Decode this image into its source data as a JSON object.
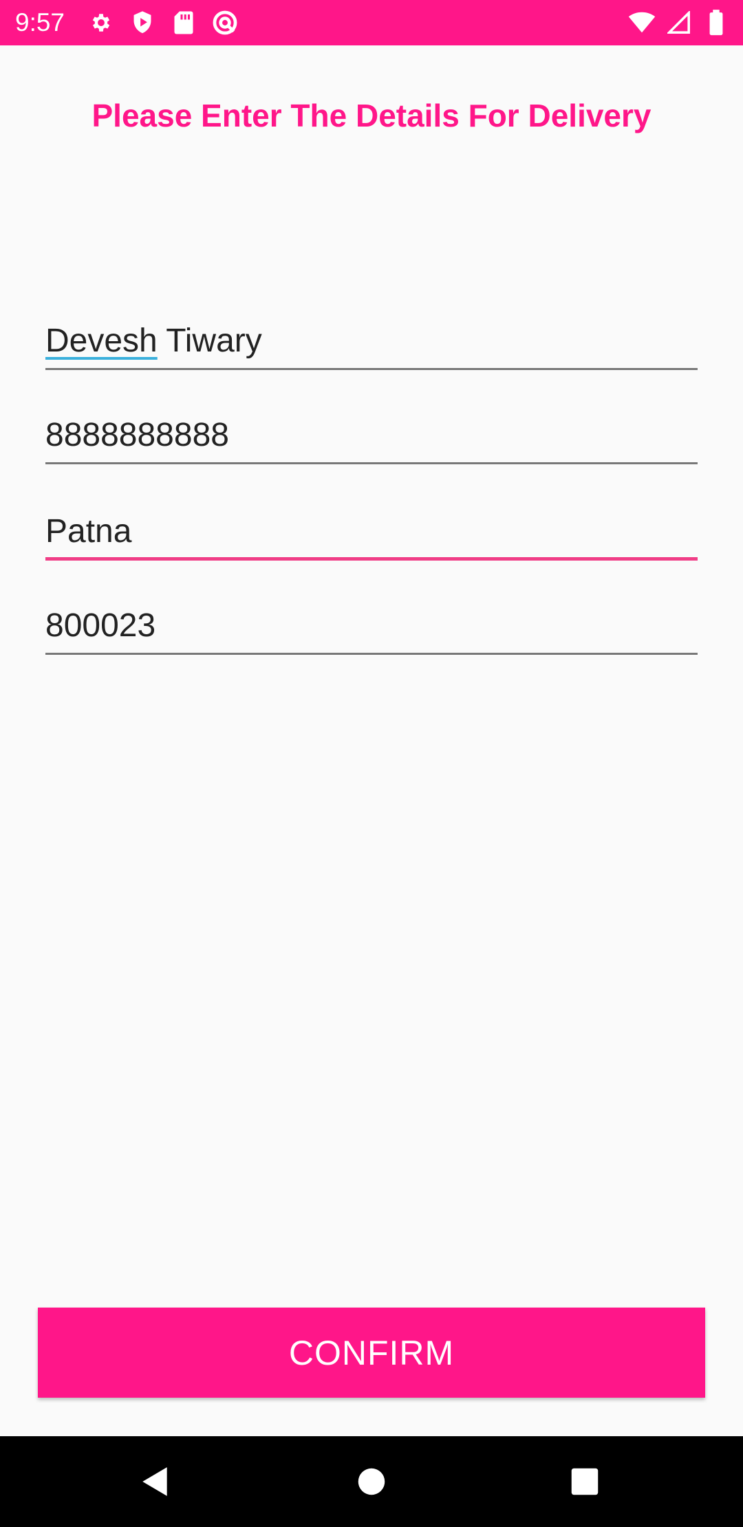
{
  "status_bar": {
    "time": "9:57",
    "left_icons": [
      "gear-icon",
      "shield-play-icon",
      "sd-card-icon",
      "at-sign-icon"
    ],
    "right_icons": [
      "wifi-icon",
      "cell-signal-icon",
      "battery-icon"
    ],
    "background": "#ff1689"
  },
  "title": "Please Enter The Details For Delivery",
  "form": {
    "name": {
      "first_word": "Devesh",
      "rest": " Tiwary"
    },
    "phone": "8888888888",
    "city": "Patna",
    "pincode": "800023"
  },
  "confirm_label": "CONFIRM",
  "colors": {
    "accent": "#ff1689",
    "focused_underline": "#f03d86",
    "spell_underline": "#3ab0dc",
    "background": "#fafafa"
  },
  "nav_bar": {
    "buttons": [
      "back-icon",
      "home-icon",
      "recents-icon"
    ]
  }
}
